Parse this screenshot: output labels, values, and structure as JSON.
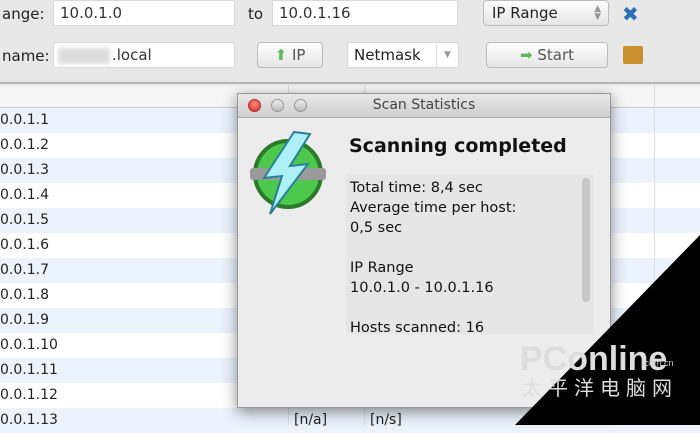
{
  "toolbar": {
    "range_label": "ange:",
    "range_from": "10.0.1.0",
    "to_label": "to",
    "range_to": "10.0.1.16",
    "mode_select": "IP Range",
    "hostname_label": "name:",
    "hostname_value": ".local",
    "ip_button": "IP",
    "netmask_select": "Netmask",
    "start_button": "Start"
  },
  "table": {
    "rows": [
      "0.0.1.1",
      "0.0.1.2",
      "0.0.1.3",
      "0.0.1.4",
      "0.0.1.5",
      "0.0.1.6",
      "0.0.1.7",
      "0.0.1.8",
      "0.0.1.9",
      "0.0.1.10",
      "0.0.1.11",
      "0.0.1.12",
      "0.0.1.13"
    ],
    "last_row_cells": [
      "[n/a]",
      "[n/s]"
    ]
  },
  "dialog": {
    "title": "Scan Statistics",
    "heading": "Scanning completed",
    "stats": "Total time: 8,4 sec\nAverage time per host:\n0,5 sec\n\nIP Range\n10.0.1.0 - 10.0.1.16\n\nHosts scanned: 16"
  },
  "watermark": {
    "brand": "PConline",
    "domain": ".com.cn",
    "cn": "太平洋电脑网"
  }
}
